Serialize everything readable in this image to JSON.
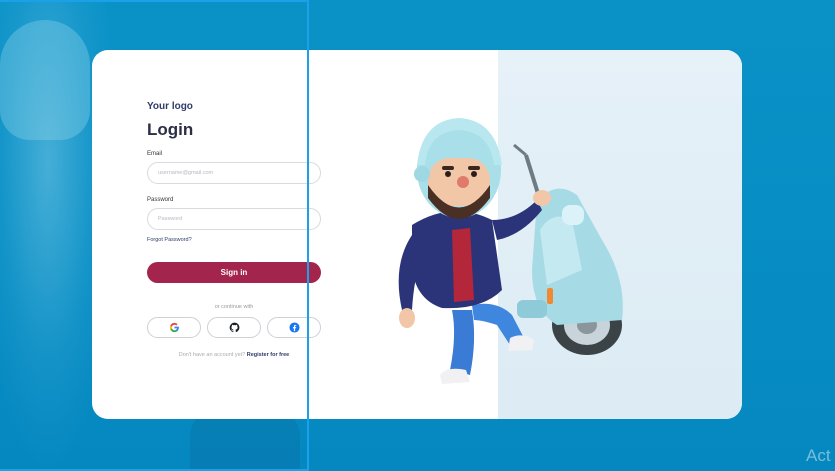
{
  "brand": {
    "logo": "Your logo"
  },
  "login": {
    "title": "Login",
    "email_label": "Email",
    "email_placeholder": "username@gmail.com",
    "password_label": "Password",
    "password_placeholder": "Password",
    "forgot_link": "Forgot Password?",
    "signin_button": "Sign in",
    "alt_text": "or continue with",
    "social": [
      {
        "name": "google",
        "icon": "google-icon"
      },
      {
        "name": "github",
        "icon": "github-icon"
      },
      {
        "name": "facebook",
        "icon": "facebook-icon"
      }
    ],
    "signup_prompt": "Don't have an account yet?",
    "signup_link": "Register for free"
  },
  "overlay": {
    "watermark": "Act"
  },
  "colors": {
    "background": "#0a92c7",
    "primary_button": "#a3244d",
    "logo_text": "#2f3b6a",
    "selection_outline": "#1aa1ea",
    "hero_panel": "#e6f1f8"
  }
}
